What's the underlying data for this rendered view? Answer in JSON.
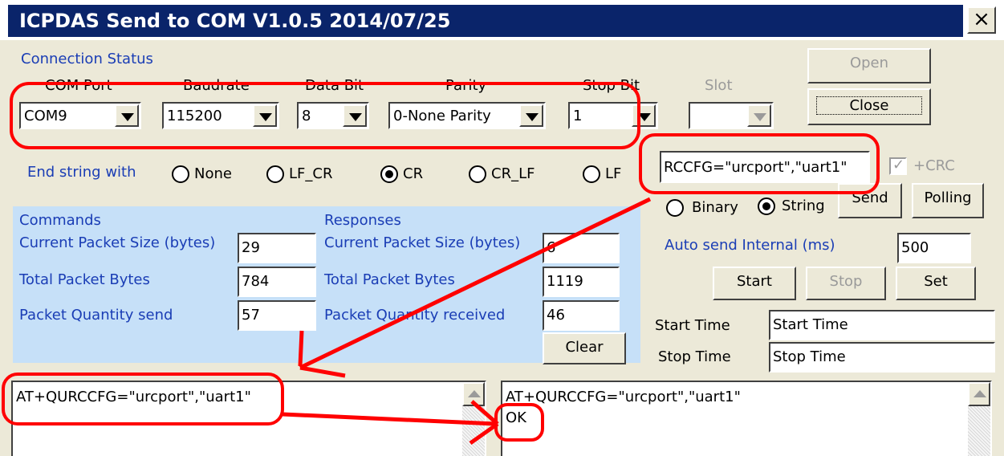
{
  "window": {
    "title": "ICPDAS Send to COM V1.0.5  2014/07/25",
    "close_glyph": "×"
  },
  "connection": {
    "status_label": "Connection Status",
    "com_port": {
      "label": "COM Port",
      "value": "COM9"
    },
    "baudrate": {
      "label": "Baudrate",
      "value": "115200"
    },
    "data_bit": {
      "label": "Data Bit",
      "value": "8"
    },
    "parity": {
      "label": "Parity",
      "value": "0-None Parity"
    },
    "stop_bit": {
      "label": "Stop Bit",
      "value": "1"
    },
    "slot": {
      "label": "Slot",
      "value": ""
    },
    "open_label": "Open",
    "close_label": "Close"
  },
  "end_string": {
    "label": "End string with",
    "options": [
      "None",
      "LF_CR",
      "CR",
      "CR_LF",
      "LF"
    ],
    "selected": "CR"
  },
  "send": {
    "command": "RCCFG=\"urcport\",\"uart1\"",
    "crc_label": "+CRC",
    "crc_checked": true,
    "mode_options": [
      "Binary",
      "String"
    ],
    "mode_selected": "String",
    "send_label": "Send",
    "polling_label": "Polling",
    "auto_label": "Auto send Internal (ms)",
    "auto_value": "500",
    "start_label": "Start",
    "stop_label": "Stop",
    "set_label": "Set",
    "start_time_label": "Start Time",
    "start_time_value": "Start Time",
    "stop_time_label": "Stop Time",
    "stop_time_value": "Stop Time"
  },
  "stats": {
    "commands_title": "Commands",
    "responses_title": "Responses",
    "cmd_current_label": "Current Packet Size (bytes)",
    "cmd_current": "29",
    "cmd_total_label": "Total Packet Bytes",
    "cmd_total": "784",
    "cmd_qty_label": "Packet Quantity send",
    "cmd_qty": "57",
    "resp_current_label": "Current Packet Size (bytes)",
    "resp_current": "6",
    "resp_total_label": "Total Packet Bytes",
    "resp_total": "1119",
    "resp_qty_label": "Packet Quantity received",
    "resp_qty": "46",
    "clear_label": "Clear"
  },
  "logs": {
    "sent": [
      "AT+QURCCFG=\"urcport\",\"uart1\""
    ],
    "received": [
      "AT+QURCCFG=\"urcport\",\"uart1\"",
      "OK"
    ]
  },
  "colors": {
    "title_bar": "#0a246a",
    "window_bg": "#ece9d8",
    "panel_bg": "#c6e0f8",
    "label_blue": "#1a3db5",
    "annotation_red": "#ff0000"
  }
}
